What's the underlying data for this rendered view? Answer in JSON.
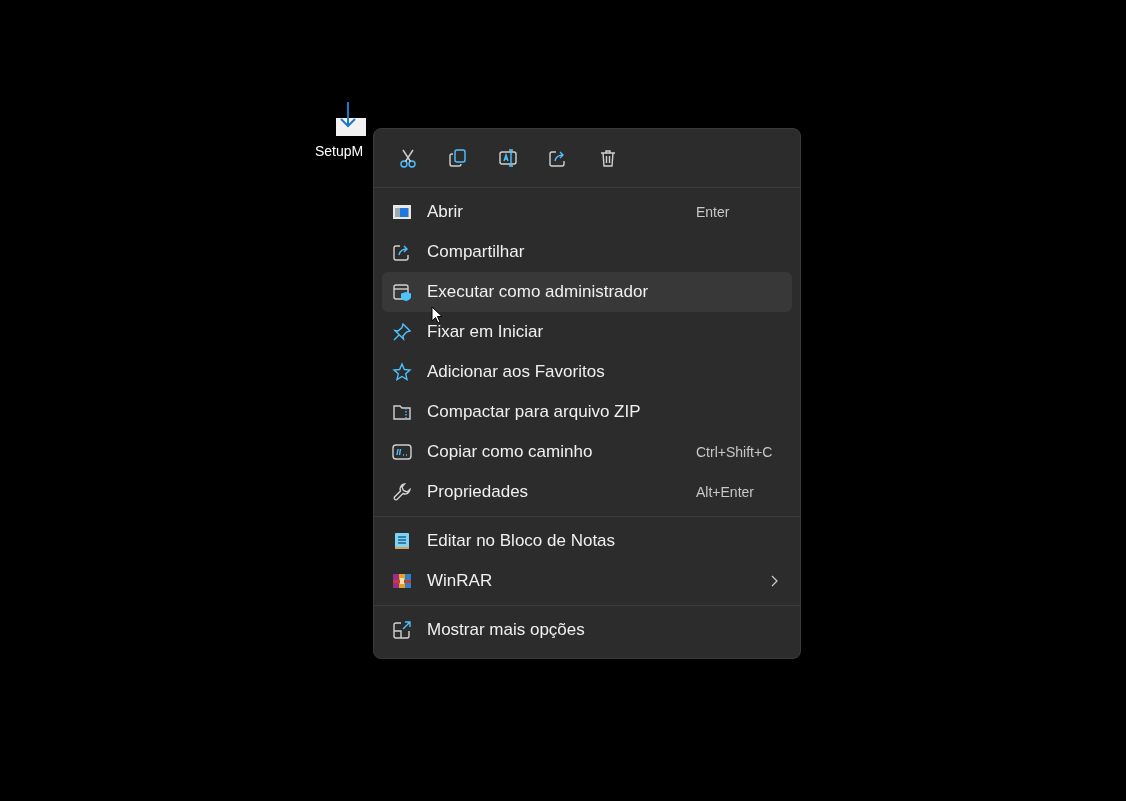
{
  "desktop_icon": {
    "label": "SetupM"
  },
  "context_menu": {
    "toolbar": [
      {
        "kind": "cut"
      },
      {
        "kind": "copy"
      },
      {
        "kind": "rename"
      },
      {
        "kind": "share"
      },
      {
        "kind": "delete"
      }
    ],
    "sections": [
      {
        "items": [
          {
            "label": "Abrir",
            "shortcut": "Enter",
            "selected": false,
            "submenu": false
          },
          {
            "label": "Compartilhar",
            "selected": false,
            "submenu": false
          },
          {
            "label": "Executar como administrador",
            "selected": true,
            "submenu": false
          },
          {
            "label": "Fixar em Iniciar",
            "selected": false,
            "submenu": false
          },
          {
            "label": "Adicionar aos Favoritos",
            "selected": false,
            "submenu": false
          },
          {
            "label": "Compactar para arquivo ZIP",
            "selected": false,
            "submenu": false
          },
          {
            "label": "Copiar como caminho",
            "shortcut": "Ctrl+Shift+C",
            "selected": false,
            "submenu": false
          },
          {
            "label": "Propriedades",
            "shortcut": "Alt+Enter",
            "selected": false,
            "submenu": false
          }
        ]
      },
      {
        "items": [
          {
            "label": "Editar no Bloco de Notas",
            "selected": false,
            "submenu": false
          },
          {
            "label": "WinRAR",
            "selected": false,
            "submenu": true
          }
        ]
      },
      {
        "items": [
          {
            "label": "Mostrar mais opções",
            "selected": false,
            "submenu": false
          }
        ]
      }
    ]
  }
}
